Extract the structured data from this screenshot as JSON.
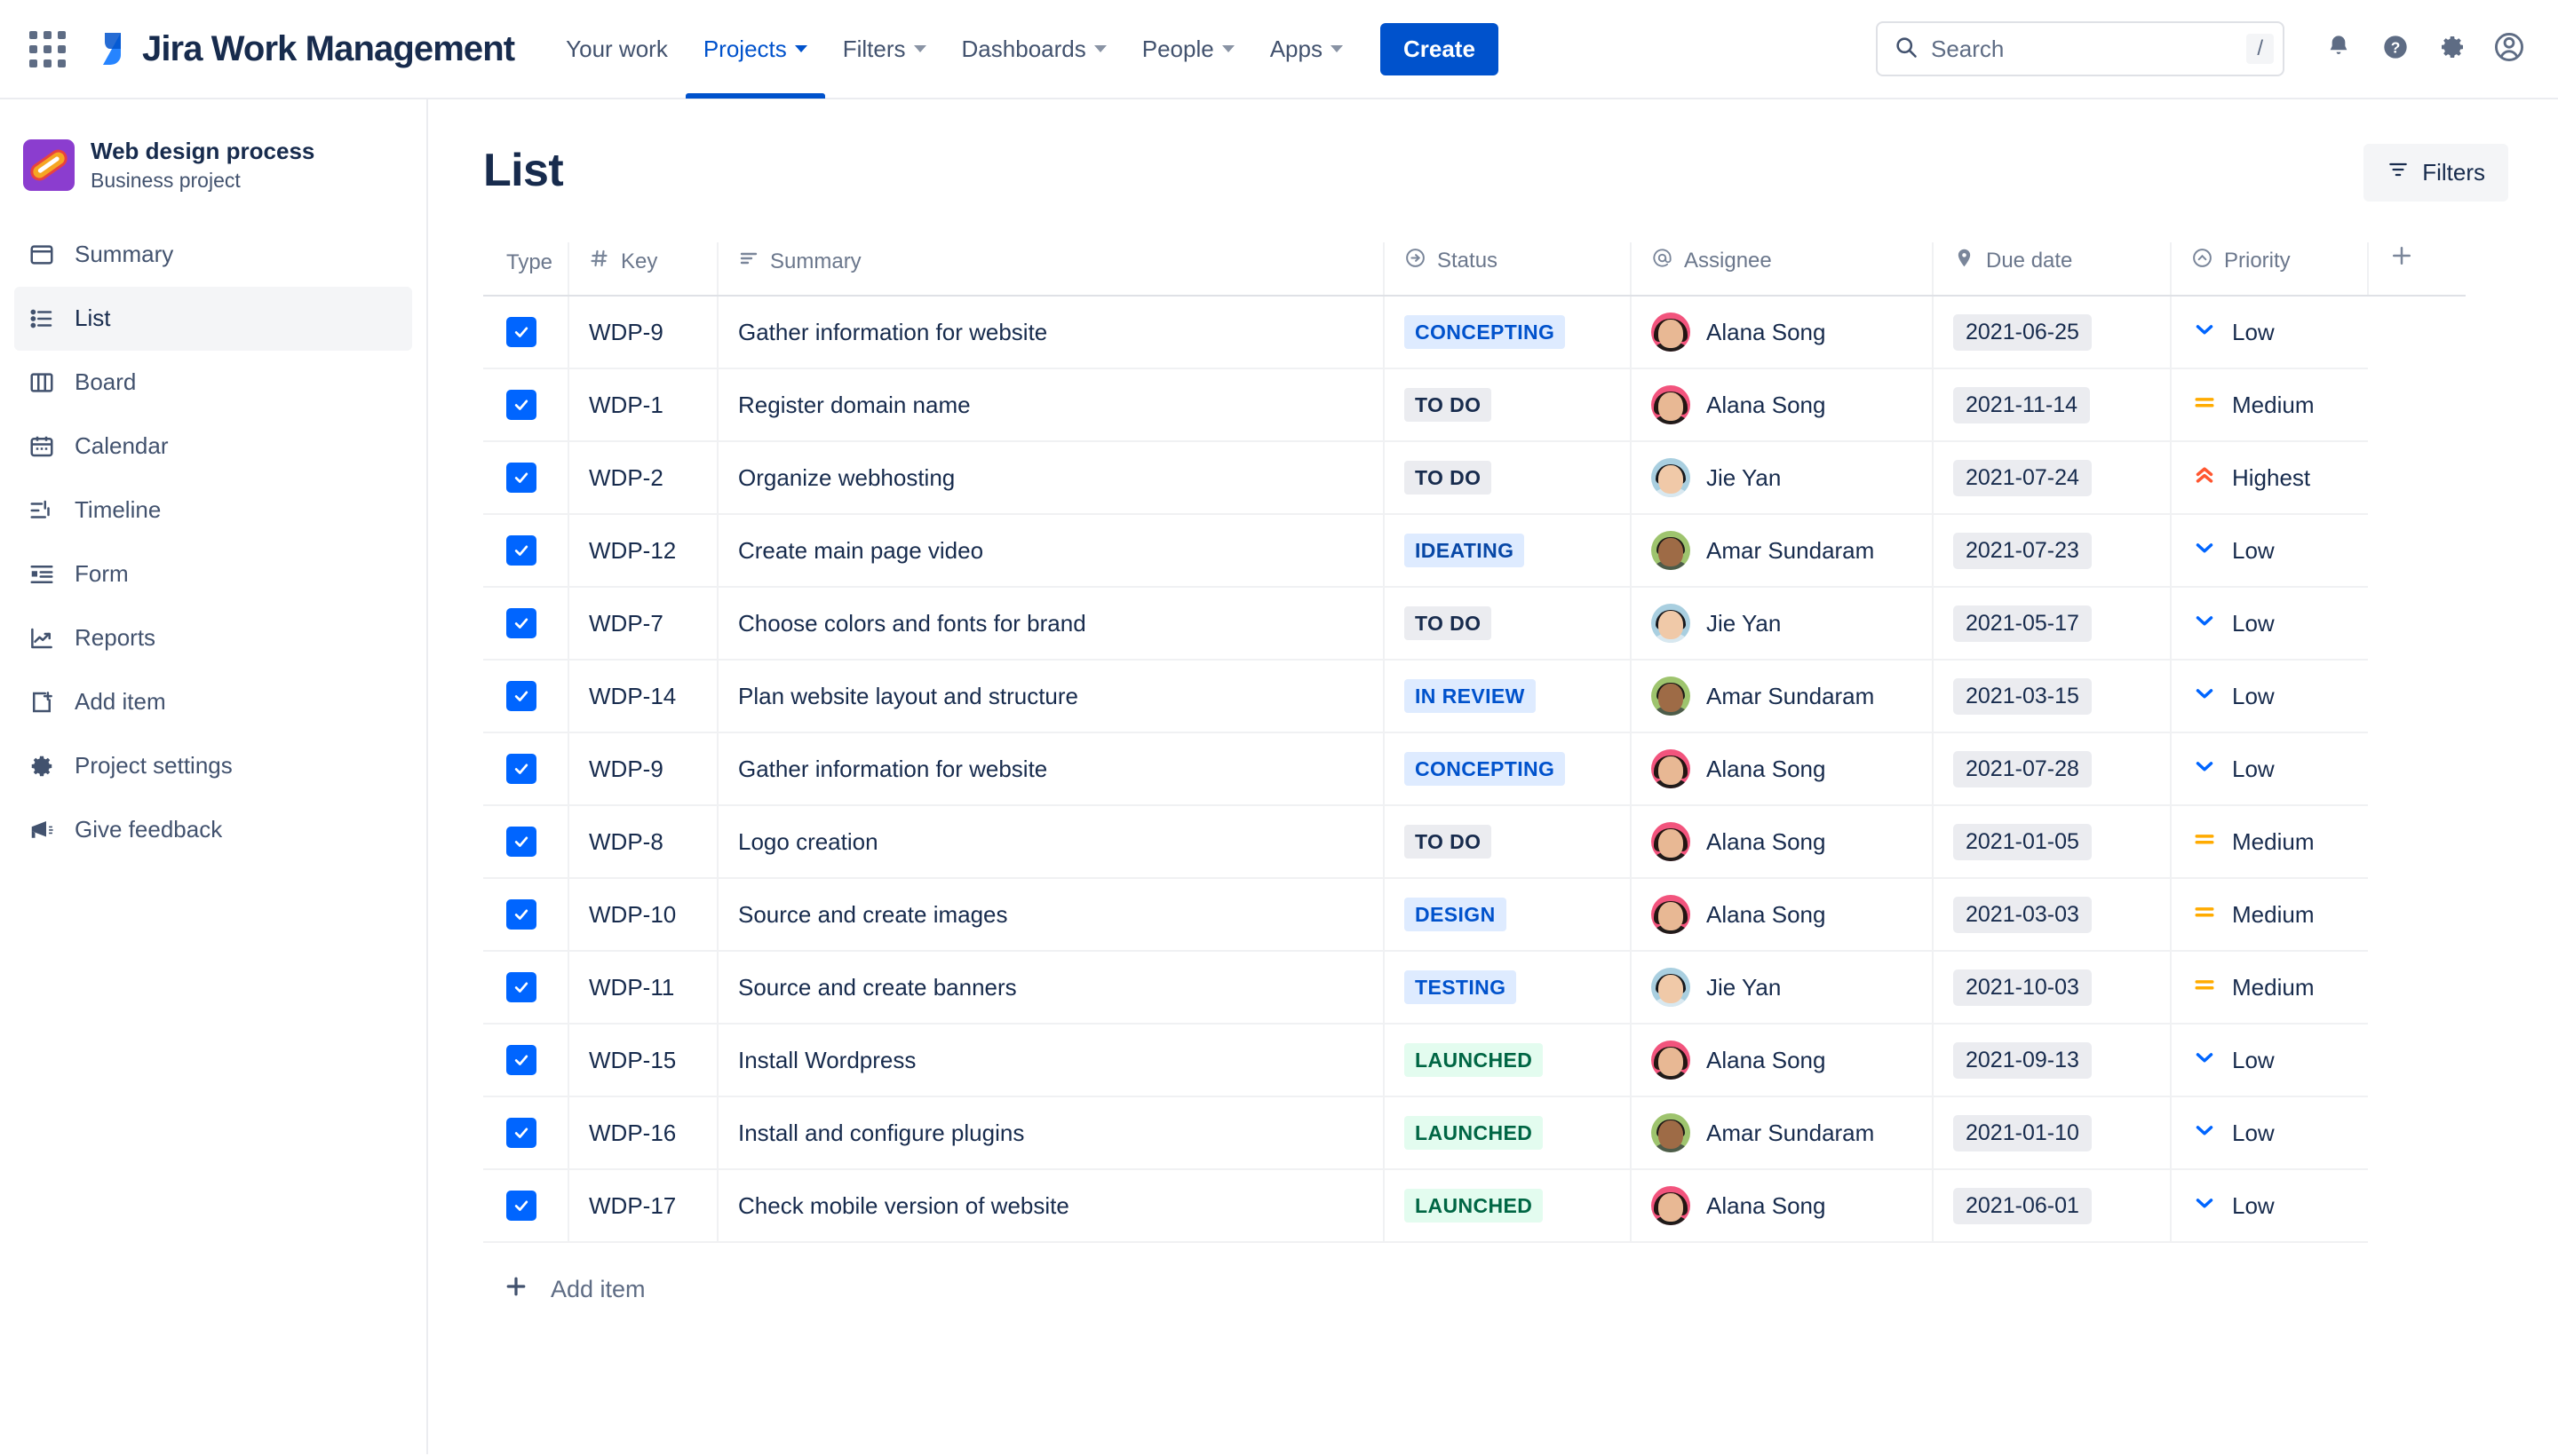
{
  "topnav": {
    "app_switcher_icon": "grid-apps-icon",
    "brand": "Jira Work Management",
    "links": [
      {
        "label": "Your work",
        "has_caret": false,
        "active": false
      },
      {
        "label": "Projects",
        "has_caret": true,
        "active": true
      },
      {
        "label": "Filters",
        "has_caret": true,
        "active": false
      },
      {
        "label": "Dashboards",
        "has_caret": true,
        "active": false
      },
      {
        "label": "People",
        "has_caret": true,
        "active": false
      },
      {
        "label": "Apps",
        "has_caret": true,
        "active": false
      }
    ],
    "create_label": "Create",
    "search": {
      "placeholder": "Search",
      "value": "",
      "shortcut": "/",
      "icon": "search-icon"
    },
    "icons": [
      "notifications-bell-icon",
      "help-question-icon",
      "settings-gear-icon",
      "user-account-icon"
    ]
  },
  "sidebar": {
    "project": {
      "name": "Web design process",
      "type": "Business project",
      "avatar_icon": "hotdog-project-icon",
      "avatar_color": "#8b3dcf"
    },
    "items": [
      {
        "label": "Summary",
        "icon": "summary-window-icon",
        "selected": false
      },
      {
        "label": "List",
        "icon": "list-bullets-icon",
        "selected": true
      },
      {
        "label": "Board",
        "icon": "board-columns-icon",
        "selected": false
      },
      {
        "label": "Calendar",
        "icon": "calendar-icon",
        "selected": false
      },
      {
        "label": "Timeline",
        "icon": "timeline-icon",
        "selected": false
      },
      {
        "label": "Form",
        "icon": "form-icon",
        "selected": false
      },
      {
        "label": "Reports",
        "icon": "reports-chart-icon",
        "selected": false
      },
      {
        "label": "Add item",
        "icon": "add-page-icon",
        "selected": false
      },
      {
        "label": "Project settings",
        "icon": "settings-gear-icon",
        "selected": false
      },
      {
        "label": "Give feedback",
        "icon": "megaphone-icon",
        "selected": false
      }
    ]
  },
  "main": {
    "title": "List",
    "filters_button": {
      "label": "Filters",
      "icon": "filter-icon"
    },
    "add_item": {
      "label": "Add item",
      "icon": "plus-icon"
    },
    "add_column_icon": "plus-icon",
    "columns": [
      {
        "key": "type",
        "label": "Type",
        "icon": null
      },
      {
        "key": "key",
        "label": "Key",
        "icon": "hash-icon"
      },
      {
        "key": "summary",
        "label": "Summary",
        "icon": "text-lines-icon"
      },
      {
        "key": "status",
        "label": "Status",
        "icon": "arrow-right-circle-icon"
      },
      {
        "key": "assignee",
        "label": "Assignee",
        "icon": "at-sign-icon"
      },
      {
        "key": "due_date",
        "label": "Due date",
        "icon": "tag-icon"
      },
      {
        "key": "priority",
        "label": "Priority",
        "icon": "chevron-up-circle-icon"
      }
    ],
    "rows": [
      {
        "checked": true,
        "key": "WDP-9",
        "summary": "Gather information for website",
        "status": "CONCEPTING",
        "status_tone": "bluebr",
        "assignee": "Alana Song",
        "avatar": "alana",
        "due_date": "2021-06-25",
        "priority": "Low",
        "priority_icon": "chevron-down-icon"
      },
      {
        "checked": true,
        "key": "WDP-1",
        "summary": "Register domain name",
        "status": "TO DO",
        "status_tone": "grey",
        "assignee": "Alana Song",
        "avatar": "alana",
        "due_date": "2021-11-14",
        "priority": "Medium",
        "priority_icon": "equals-icon"
      },
      {
        "checked": true,
        "key": "WDP-2",
        "summary": "Organize webhosting",
        "status": "TO DO",
        "status_tone": "grey",
        "assignee": "Jie Yan",
        "avatar": "jie",
        "due_date": "2021-07-24",
        "priority": "Highest",
        "priority_icon": "double-chevron-up-icon"
      },
      {
        "checked": true,
        "key": "WDP-12",
        "summary": "Create main page video",
        "status": "IDEATING",
        "status_tone": "blue",
        "assignee": "Amar Sundaram",
        "avatar": "amar",
        "due_date": "2021-07-23",
        "priority": "Low",
        "priority_icon": "chevron-down-icon"
      },
      {
        "checked": true,
        "key": "WDP-7",
        "summary": "Choose colors and fonts for brand",
        "status": "TO DO",
        "status_tone": "grey",
        "assignee": "Jie Yan",
        "avatar": "jie",
        "due_date": "2021-05-17",
        "priority": "Low",
        "priority_icon": "chevron-down-icon"
      },
      {
        "checked": true,
        "key": "WDP-14",
        "summary": "Plan website layout and structure",
        "status": "IN REVIEW",
        "status_tone": "bluebr",
        "assignee": "Amar Sundaram",
        "avatar": "amar",
        "due_date": "2021-03-15",
        "priority": "Low",
        "priority_icon": "chevron-down-icon"
      },
      {
        "checked": true,
        "key": "WDP-9",
        "summary": "Gather information for website",
        "status": "CONCEPTING",
        "status_tone": "bluebr",
        "assignee": "Alana Song",
        "avatar": "alana",
        "due_date": "2021-07-28",
        "priority": "Low",
        "priority_icon": "chevron-down-icon"
      },
      {
        "checked": true,
        "key": "WDP-8",
        "summary": "Logo creation",
        "status": "TO DO",
        "status_tone": "grey",
        "assignee": "Alana Song",
        "avatar": "alana",
        "due_date": "2021-01-05",
        "priority": "Medium",
        "priority_icon": "equals-icon"
      },
      {
        "checked": true,
        "key": "WDP-10",
        "summary": "Source and create images",
        "status": "DESIGN",
        "status_tone": "bluebr",
        "assignee": "Alana Song",
        "avatar": "alana",
        "due_date": "2021-03-03",
        "priority": "Medium",
        "priority_icon": "equals-icon"
      },
      {
        "checked": true,
        "key": "WDP-11",
        "summary": "Source and create banners",
        "status": "TESTING",
        "status_tone": "bluebr",
        "assignee": "Jie Yan",
        "avatar": "jie",
        "due_date": "2021-10-03",
        "priority": "Medium",
        "priority_icon": "equals-icon"
      },
      {
        "checked": true,
        "key": "WDP-15",
        "summary": "Install Wordpress",
        "status": "LAUNCHED",
        "status_tone": "green",
        "assignee": "Alana Song",
        "avatar": "alana",
        "due_date": "2021-09-13",
        "priority": "Low",
        "priority_icon": "chevron-down-icon"
      },
      {
        "checked": true,
        "key": "WDP-16",
        "summary": "Install and configure plugins",
        "status": "LAUNCHED",
        "status_tone": "green",
        "assignee": "Amar Sundaram",
        "avatar": "amar",
        "due_date": "2021-01-10",
        "priority": "Low",
        "priority_icon": "chevron-down-icon"
      },
      {
        "checked": true,
        "key": "WDP-17",
        "summary": "Check mobile version of website",
        "status": "LAUNCHED",
        "status_tone": "green",
        "assignee": "Alana Song",
        "avatar": "alana",
        "due_date": "2021-06-01",
        "priority": "Low",
        "priority_icon": "chevron-down-icon"
      }
    ]
  },
  "colors": {
    "brand_blue": "#0052cc",
    "checkbox_blue": "#0065ff",
    "priority_low": "#0065ff",
    "priority_medium": "#ffab00",
    "priority_highest": "#ff5630",
    "status_green_bg": "#e3fcef",
    "status_blue_bg": "#deebff",
    "status_grey_bg": "#ebecf0"
  }
}
